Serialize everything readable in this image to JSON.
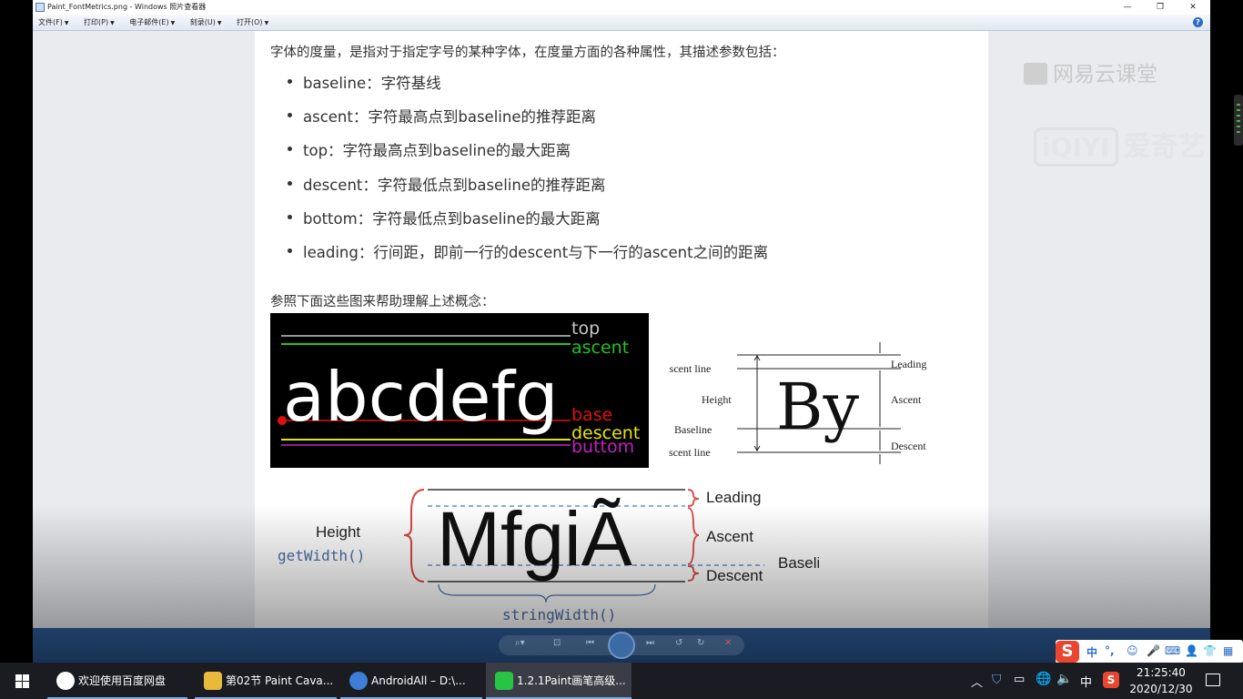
{
  "window": {
    "title": "Paint_FontMetrics.png - Windows 照片查看器",
    "controls": {
      "min": "—",
      "restore": "❐",
      "close": "✕"
    },
    "menu": [
      {
        "label": "文件(F)"
      },
      {
        "label": "打印(P)"
      },
      {
        "label": "电子邮件(E)"
      },
      {
        "label": "刻录(U)"
      },
      {
        "label": "打开(O)"
      }
    ],
    "help": "?"
  },
  "document": {
    "intro": "字体的度量，是指对于指定字号的某种字体，在度量方面的各种属性，其描述参数包括：",
    "definitions": [
      "baseline：字符基线",
      "ascent：字符最高点到baseline的推荐距离",
      "top：字符最高点到baseline的最大距离",
      "descent：字符最低点到baseline的推荐距离",
      "bottom：字符最低点到baseline的最大距离",
      "leading：行间距，即前一行的descent与下一行的ascent之间的距离"
    ],
    "see_below": "参照下面这些图来帮助理解上述概念："
  },
  "figure1": {
    "sample": "abcdefg",
    "labels": {
      "top": "top",
      "ascent": "ascent",
      "base": "base",
      "descent": "descent",
      "bottom": "buttom"
    },
    "colors": {
      "top": "#c8c8c8",
      "ascent": "#22c322",
      "base": "#e01010",
      "descent": "#e6e600",
      "bottom": "#c020c0"
    }
  },
  "figure2": {
    "sample": "By",
    "left_labels": {
      "ascent_line": "Ascent line",
      "height": "Height",
      "baseline": "Baseline",
      "descent_line": "Descent line"
    },
    "right_labels": {
      "leading": "Leading",
      "ascent": "Ascent",
      "descent": "Descent"
    }
  },
  "figure3": {
    "sample": "MfgiÃ",
    "labels": {
      "height": "Height",
      "getwidth": "getWidth()",
      "leading": "Leading",
      "ascent": "Ascent",
      "baseline": "Baseline",
      "descent": "Descent",
      "stringwidth": "stringWidth()"
    },
    "colors": {
      "brace": "#d9473f",
      "code": "#4a6fa5",
      "dash": "#6a8fcf"
    }
  },
  "watermarks": {
    "netease": "网易云课堂",
    "iqiyi_logo": "iQIYI",
    "iqiyi_text": "爱奇艺"
  },
  "taskbar": {
    "items": [
      {
        "label": "欢迎使用百度网盘",
        "icon": "baidu-netdisk-icon"
      },
      {
        "label": "第02节 Paint Cava...",
        "icon": "folder-icon"
      },
      {
        "label": "AndroidAll – D:\\...",
        "icon": "android-studio-icon"
      },
      {
        "label": "1.2.1Paint画笔高级...",
        "icon": "iqiyi-icon"
      }
    ],
    "tray": {
      "ime_lang": "中",
      "time": "21:25:40",
      "date": "2020/12/30"
    }
  },
  "ime_bar": {
    "logo": "S",
    "lang": "中"
  }
}
